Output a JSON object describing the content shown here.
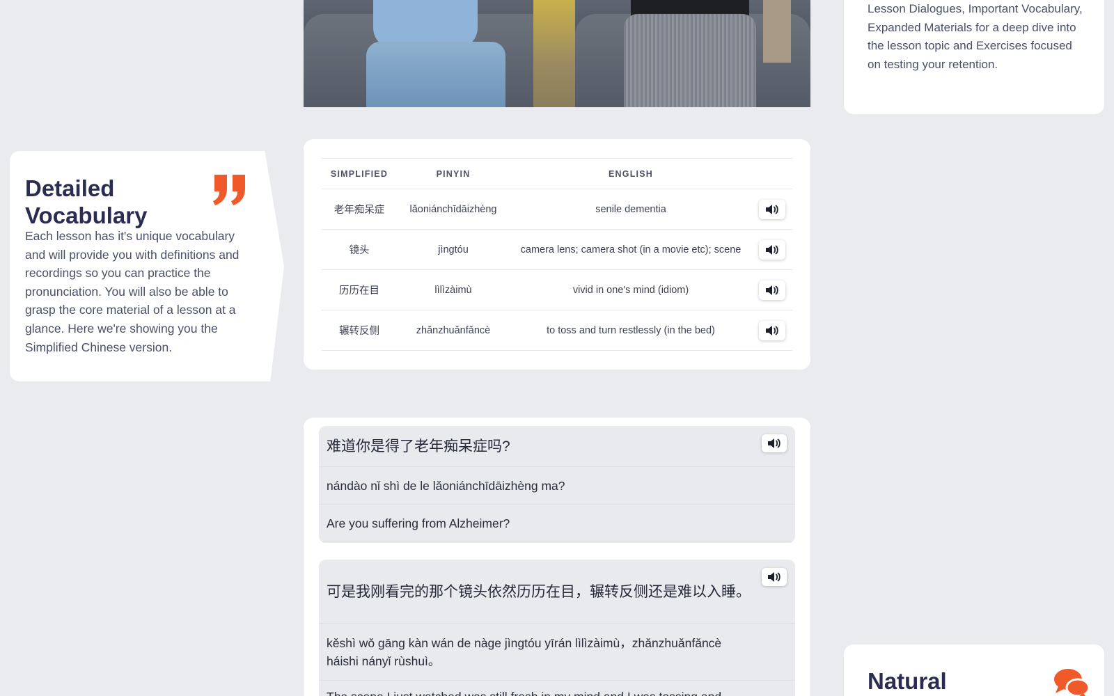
{
  "video": {
    "alt": "lesson video still"
  },
  "top_right_card": {
    "text": "Lesson Dialogues, Important Vocabulary, Expanded Materials for a deep dive into the lesson topic and Exercises focused on testing your retention."
  },
  "vocab_info": {
    "title": "Detailed Vocabulary",
    "description": "Each lesson has it's unique vocabulary and will provide you with definitions and recordings so you can practice the pronunciation. You will also be able to grasp the core material of a lesson at a glance. Here we're showing you the Simplified Chinese version.",
    "icon": "quote-icon",
    "accent_color": "#f05a2a"
  },
  "vocab_table": {
    "headers": [
      "SIMPLIFIED",
      "PINYIN",
      "ENGLISH"
    ],
    "rows": [
      {
        "simplified": "老年痴呆症",
        "pinyin": "lǎoniánchīdāizhèng",
        "english": "senile dementia"
      },
      {
        "simplified": "镜头",
        "pinyin": "jìngtóu",
        "english": "camera lens; camera shot (in a movie etc); scene"
      },
      {
        "simplified": "历历在目",
        "pinyin": "lìlìzàimù",
        "english": "vivid in one's mind (idiom)"
      },
      {
        "simplified": "辗转反侧",
        "pinyin": "zhǎnzhuǎnfǎncè",
        "english": "to toss and turn restlessly (in the bed)"
      }
    ],
    "audio_icon": "speaker-icon"
  },
  "dialogue": [
    {
      "hanzi": "难道你是得了老年痴呆症吗?",
      "pinyin": "nándào nǐ shì de le lǎoniánchīdāizhèng ma?",
      "english": "Are you suffering from Alzheimer?"
    },
    {
      "hanzi": "可是我刚看完的那个镜头依然历历在目，辗转反侧还是难以入睡。",
      "pinyin": "kěshì wǒ gāng kàn wán de nàge jìngtóu yīrán lìlìzàimù，zhǎnzhuǎnfǎncè háishi nányǐ rùshuì。",
      "english": "The scene I just watched was still fresh in my mind and I was tossing and turning"
    }
  ],
  "natural_card": {
    "title": "Natural",
    "icon": "chat-bubbles-icon",
    "accent_color": "#f05a2a"
  }
}
